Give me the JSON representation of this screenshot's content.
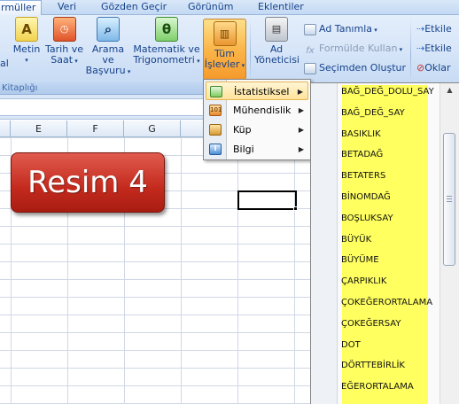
{
  "ribbon": {
    "tabs": [
      "rmüller",
      "Veri",
      "Gözden Geçir",
      "Görünüm",
      "Eklentiler"
    ],
    "active_tab": 0,
    "group_label_left": "Kitaplığı",
    "buttons": {
      "metin": "Metin",
      "tarih_line1": "Tarih ve",
      "tarih_line2": "Saat",
      "arama_line1": "Arama ve",
      "arama_line2": "Başvuru",
      "mat_line1": "Matematik ve",
      "mat_line2": "Trigonometri",
      "tum_line1": "Tüm",
      "tum_line2": "İşlevler",
      "ad_line1": "Ad",
      "ad_line2": "Yöneticisi",
      "left_cut": "al"
    },
    "names": {
      "ad_tanimla": "Ad Tanımla",
      "formulde_kullan": "Formülde Kullan",
      "secimden_olustur": "Seçimden Oluştur"
    },
    "right_cut": {
      "etkile1": "Etkile",
      "etkile2": "Etkile",
      "oklar": "Oklar"
    }
  },
  "grid": {
    "columns": [
      "E",
      "F",
      "G"
    ]
  },
  "badge": {
    "text": "Resim 4"
  },
  "menu": {
    "items": [
      {
        "label": "İstatistiksel",
        "icon": "chart-icon",
        "highlighted": true
      },
      {
        "label": "Mühendislik",
        "icon": "engineering-icon",
        "highlighted": false
      },
      {
        "label": "Küp",
        "icon": "cube-icon",
        "highlighted": false
      },
      {
        "label": "Bilgi",
        "icon": "info-icon",
        "highlighted": false
      }
    ]
  },
  "submenu": {
    "functions": [
      "BAĞ_DEĞ_DOLU_SAY",
      "BAĞ_DEĞ_SAY",
      "BASIKLIK",
      "BETADAĞ",
      "BETATERS",
      "BİNOMDAĞ",
      "BOŞLUKSAY",
      "BÜYÜK",
      "BÜYÜME",
      "ÇARPIKLIK",
      "ÇOKEĞERORTALAMA",
      "ÇOKEĞERSAY",
      "DOT",
      "DÖRTTEBİRLİK",
      "EĞERORTALAMA"
    ]
  },
  "colors": {
    "highlight": "#ffff60",
    "badge": "#c32a1d",
    "ribbon_text": "#15428b"
  }
}
